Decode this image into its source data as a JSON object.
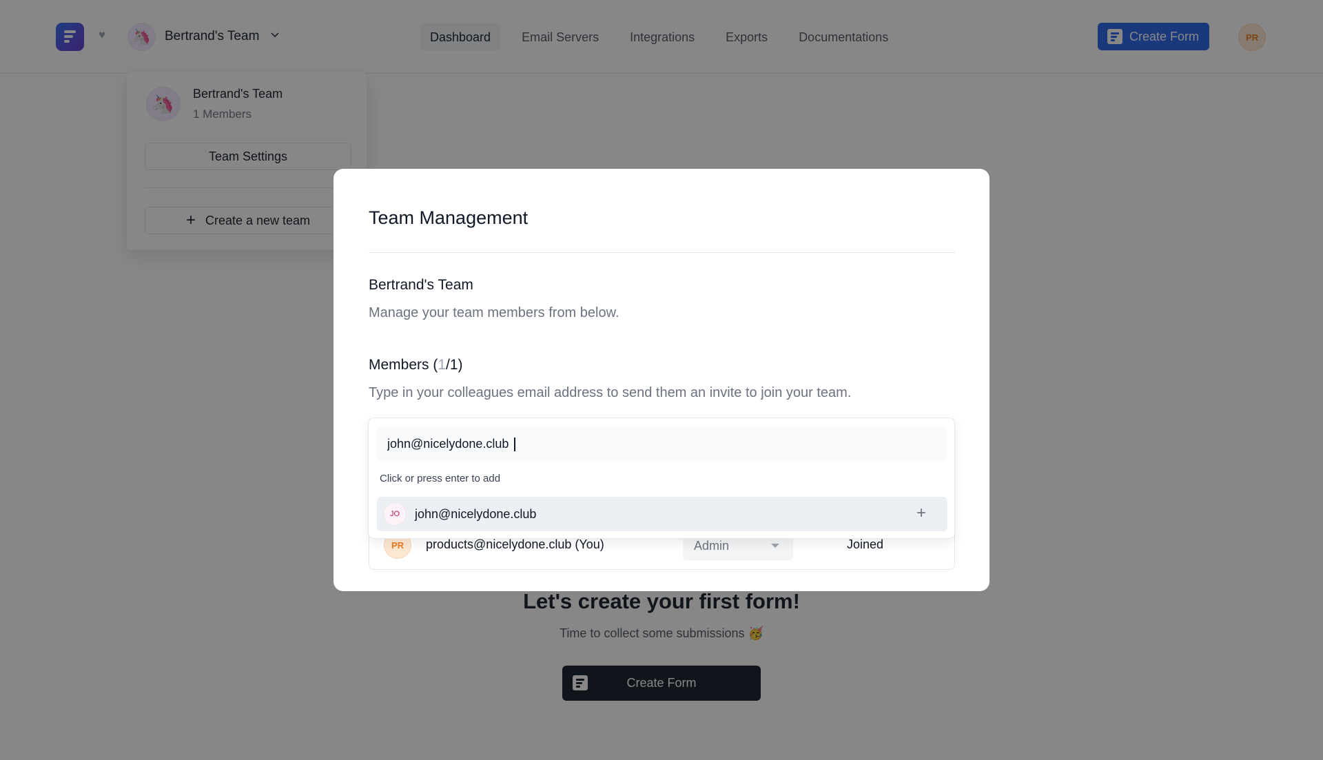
{
  "header": {
    "team_name": "Bertrand's Team",
    "nav": [
      "Dashboard",
      "Email Servers",
      "Integrations",
      "Exports",
      "Documentations"
    ],
    "active_nav": "Dashboard",
    "create_form_label": "Create Form",
    "user_initials": "PR"
  },
  "team_dropdown": {
    "team_name": "Bertrand's Team",
    "members_text": "1 Members",
    "settings_label": "Team Settings",
    "new_team_label": "Create a new team"
  },
  "empty_state": {
    "title": "Let's create your first form!",
    "subtitle": "Time to collect some submissions 🥳",
    "button_label": "Create Form"
  },
  "modal": {
    "title": "Team Management",
    "team_name": "Bertrand's Team",
    "team_subtitle": "Manage your team members from below.",
    "members_label_prefix": "Members (",
    "members_count": "1",
    "members_label_suffix": "/1)",
    "members_subtitle": "Type in your colleagues email address to send them an invite to join your team.",
    "invite": {
      "value": "john@nicelydone.club",
      "hint": "Click or press enter to add",
      "suggestion_initials": "JO",
      "suggestion_email": "john@nicelydone.club"
    },
    "members": [
      {
        "initials": "PR",
        "email": "products@nicelydone.club (You)",
        "role": "Admin",
        "status": "Joined"
      }
    ]
  },
  "colors": {
    "primary": "#2563eb",
    "dark": "#111827",
    "overlay": "rgba(15,15,15,0.5)"
  }
}
